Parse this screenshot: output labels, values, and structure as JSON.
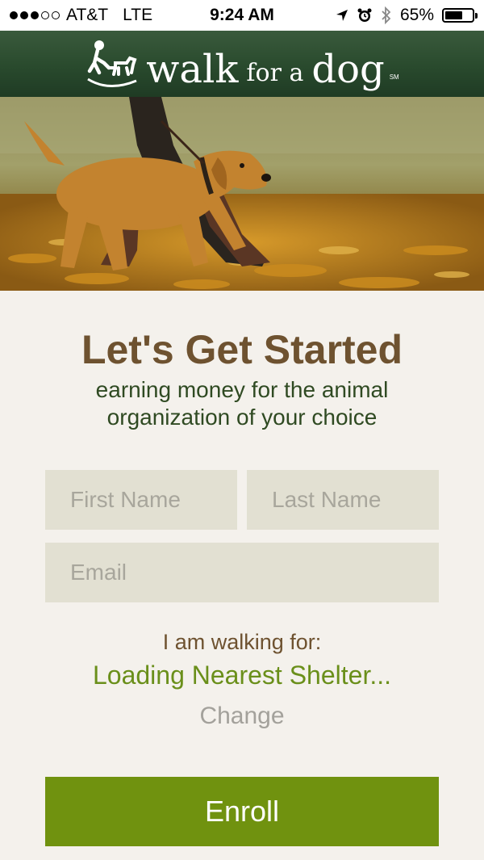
{
  "status_bar": {
    "carrier": "AT&T",
    "network": "LTE",
    "time": "9:24 AM",
    "battery_percent": "65%",
    "battery_level": 0.65,
    "signal_bars_filled": 3,
    "signal_bars_total": 5
  },
  "brand": {
    "word_walk": "walk",
    "word_for_a": "for a",
    "word_dog": "dog",
    "service_mark": "SM"
  },
  "hero": {
    "icon": "dog-walking-photo"
  },
  "form": {
    "heading": "Let's Get Started",
    "subheading": "earning money for the animal organization of your choice",
    "first_name_placeholder": "First Name",
    "last_name_placeholder": "Last Name",
    "email_placeholder": "Email",
    "walking_for_label": "I am walking for:",
    "shelter_status": "Loading Nearest Shelter...",
    "change_label": "Change",
    "enroll_label": "Enroll"
  },
  "colors": {
    "brand_green": "#2b4a2e",
    "heading_brown": "#6e5230",
    "subheading_green": "#2f4a22",
    "shelter_green": "#6a8f1a",
    "enroll_green": "#70920f",
    "field_bg": "#e2e0d2",
    "page_bg": "#f4f1ec"
  }
}
